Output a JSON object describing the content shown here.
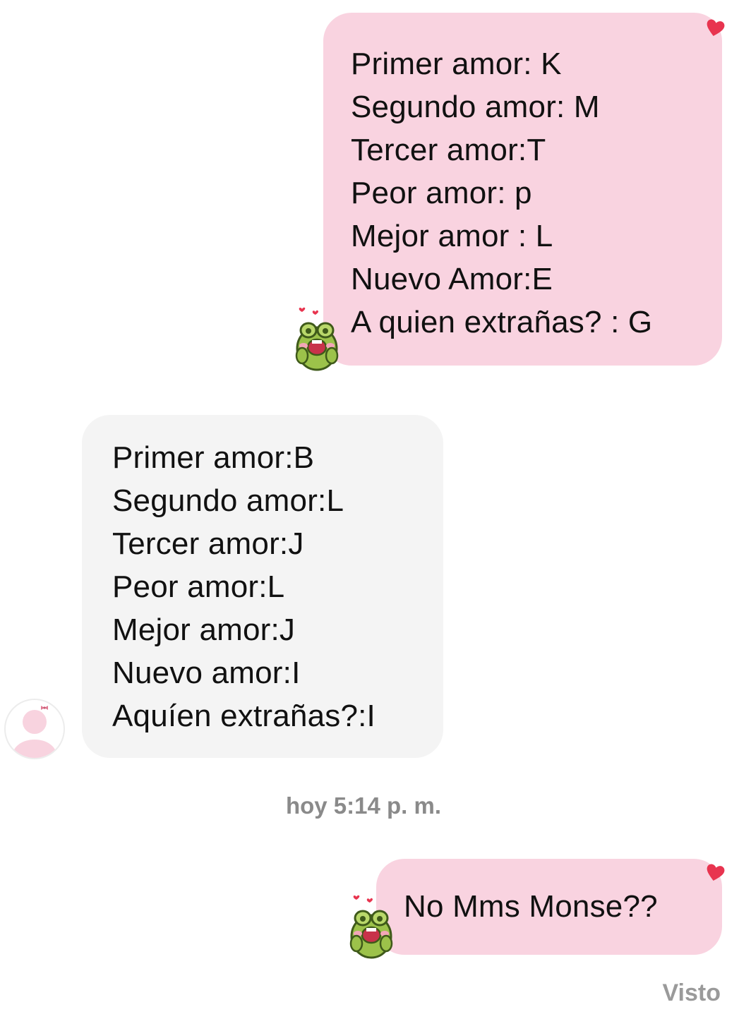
{
  "messages": [
    {
      "sender": "me",
      "lines": [
        "Primer amor: K",
        "Segundo amor: M",
        "Tercer amor:T",
        "Peor amor: p",
        "Mejor amor : L",
        "Nuevo Amor:E",
        "A quien extrañas? : G"
      ],
      "reaction_icon": "heart-icon",
      "sticker_icon": "frog-sticker-icon"
    },
    {
      "sender": "other",
      "lines": [
        "Primer amor:B",
        "Segundo amor:L",
        "Tercer amor:J",
        "Peor amor:L",
        "Mejor amor:J",
        "Nuevo amor:I",
        "Aquíen extrañas?:I"
      ],
      "avatar_icon": "default-avatar-icon"
    },
    {
      "sender": "me",
      "lines": [
        "No Mms Monse??"
      ],
      "reaction_icon": "heart-icon",
      "sticker_icon": "frog-sticker-icon"
    }
  ],
  "timestamp": {
    "day": "hoy",
    "time": "5:14 p. m."
  },
  "seen_status": "Visto",
  "colors": {
    "sent_bubble": "#f9d3e0",
    "received_bubble": "#f4f4f4",
    "heart": "#e8344f",
    "meta_text": "#8a8a8a"
  }
}
